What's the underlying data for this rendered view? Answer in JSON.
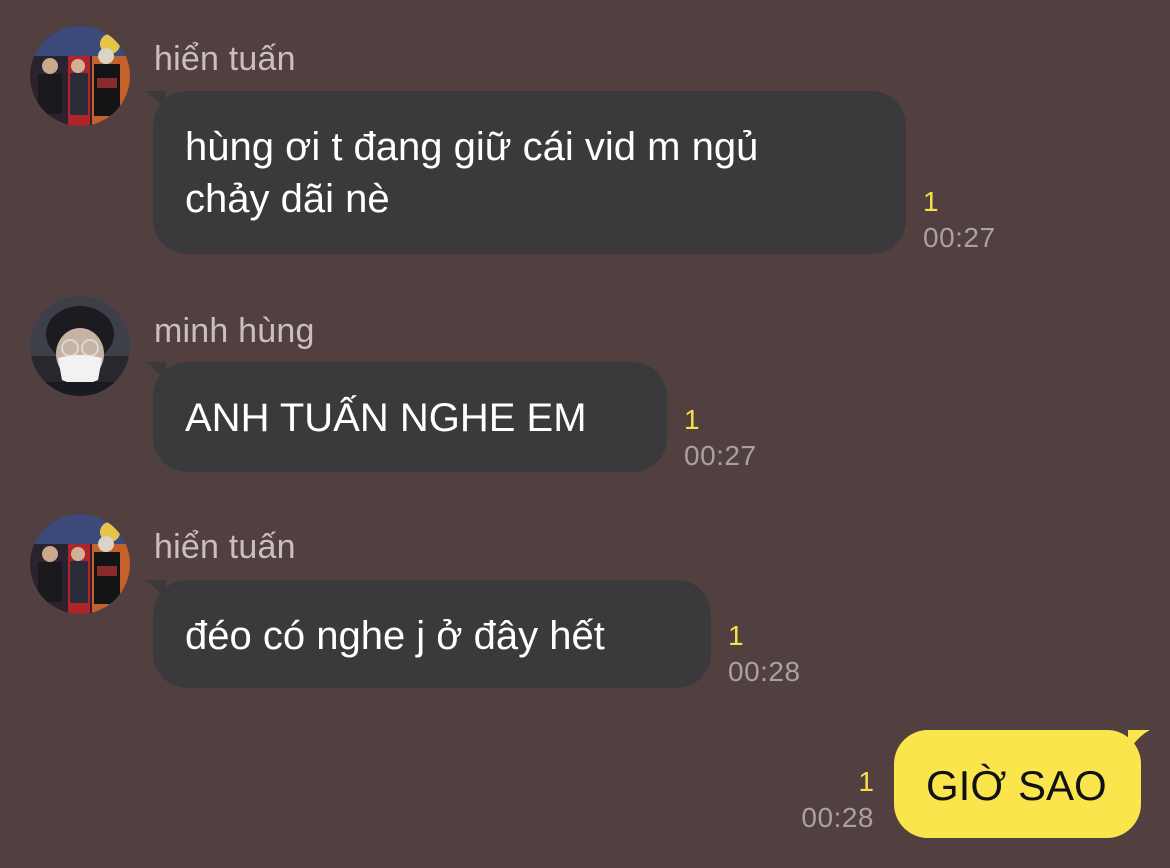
{
  "messages": [
    {
      "sender": "hiển tuấn",
      "avatar": "group-photo-avatar",
      "text": "hùng ơi t đang giữ cái vid m ngủ\nchảy dãi nè",
      "unread": "1",
      "time": "00:27"
    },
    {
      "sender": "minh hùng",
      "avatar": "masked-person-avatar",
      "text": "ANH TUẤN NGHE EM",
      "unread": "1",
      "time": "00:27"
    },
    {
      "sender": "hiển tuấn",
      "avatar": "group-photo-avatar",
      "text": "đéo có nghe j ở đây hết",
      "unread": "1",
      "time": "00:28"
    },
    {
      "sender": "",
      "avatar": "",
      "text": "GIỜ SAO",
      "unread": "1",
      "time": "00:28",
      "mine": true
    }
  ],
  "colors": {
    "background": "#524041",
    "incoming_bubble": "#3a3a3c",
    "outgoing_bubble": "#fbe54d",
    "unread_count": "#f5e04a",
    "timestamp": "#a7a1a2",
    "sender_name": "#c9bfc0"
  }
}
